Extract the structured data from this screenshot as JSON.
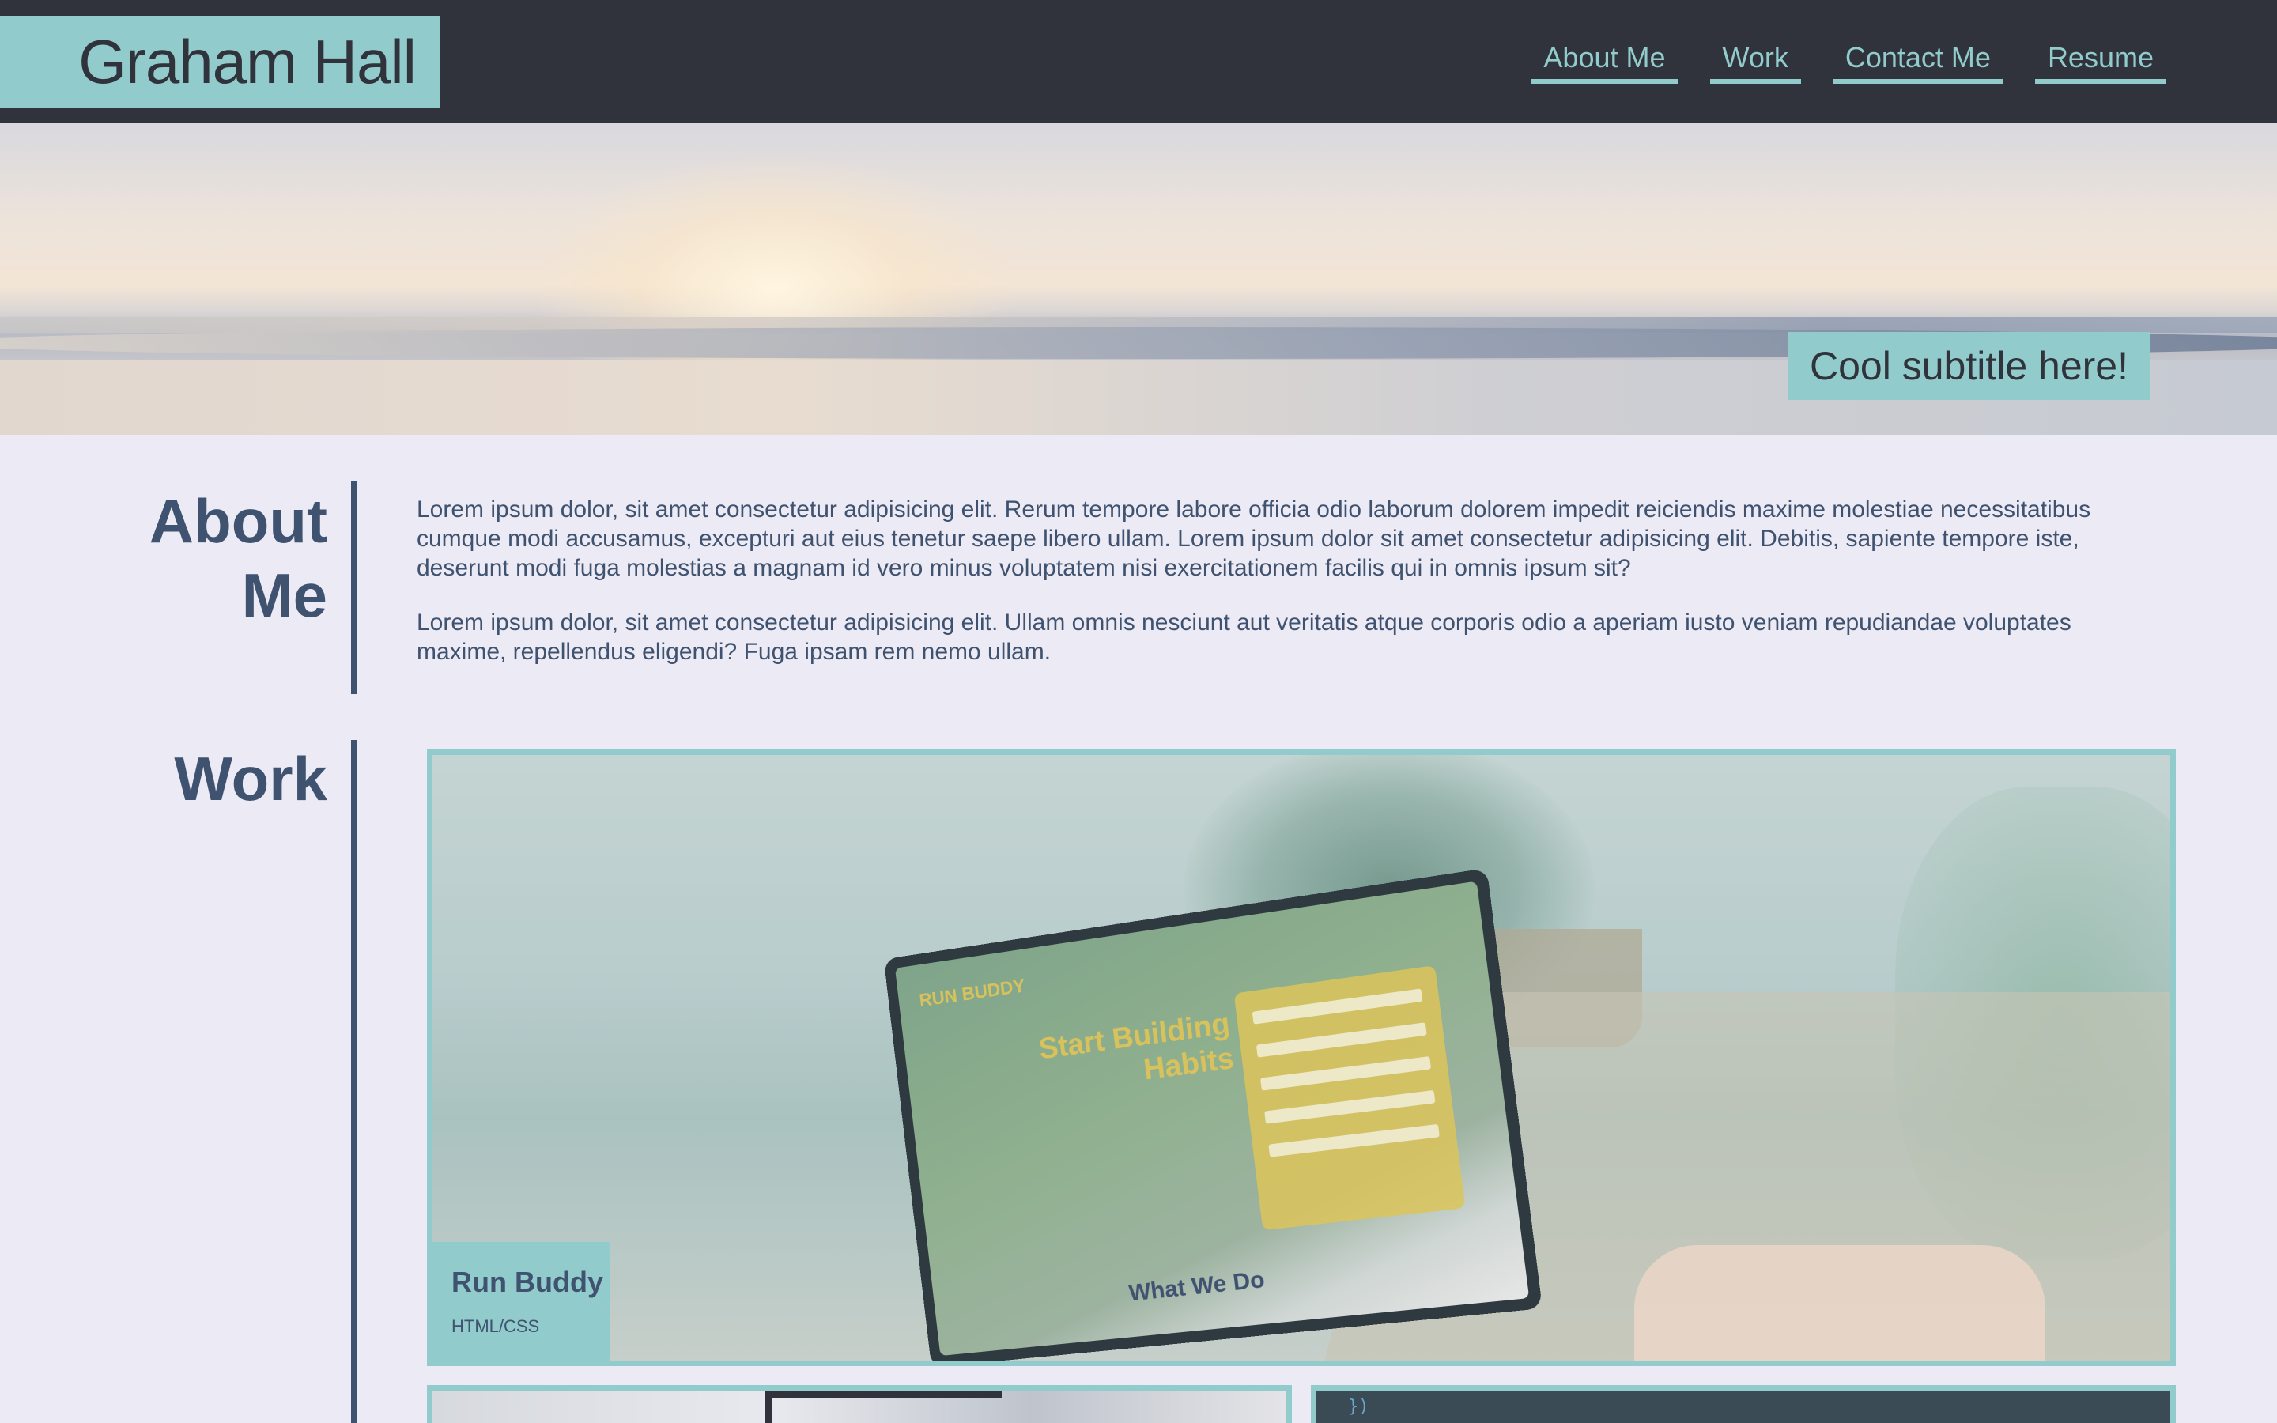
{
  "header": {
    "brand": "Graham Hall",
    "nav": [
      "About Me",
      "Work",
      "Contact Me",
      "Resume"
    ]
  },
  "hero": {
    "subtitle": "Cool subtitle here!"
  },
  "about": {
    "title_line1": "About",
    "title_line2": "Me",
    "paragraphs": [
      "Lorem ipsum dolor, sit amet consectetur adipisicing elit. Rerum tempore labore officia odio laborum dolorem impedit reiciendis maxime molestiae necessitatibus cumque modi accusamus, excepturi aut eius tenetur saepe libero ullam. Lorem ipsum dolor sit amet consectetur adipisicing elit. Debitis, sapiente tempore iste, deserunt modi fuga molestias a magnam id vero minus voluptatem nisi exercitationem facilis qui in omnis ipsum sit?",
      "Lorem ipsum dolor, sit amet consectetur adipisicing elit. Ullam omnis nesciunt aut veritatis atque corporis odio a aperiam iusto veniam repudiandae voluptates maxime, repellendus eligendi? Fuga ipsam rem nemo ullam."
    ]
  },
  "work": {
    "title": "Work",
    "projects": [
      {
        "name": "Run Buddy",
        "tech": "HTML/CSS",
        "screenshot": {
          "logo": "RUN BUDDY",
          "headline": "Start Building Habits",
          "section": "What We Do"
        }
      }
    ],
    "code_snippet": "})"
  },
  "colors": {
    "header_bg": "#30333c",
    "accent": "#92cbcb",
    "text": "#3f5370",
    "page_bg": "#eceaf4"
  }
}
